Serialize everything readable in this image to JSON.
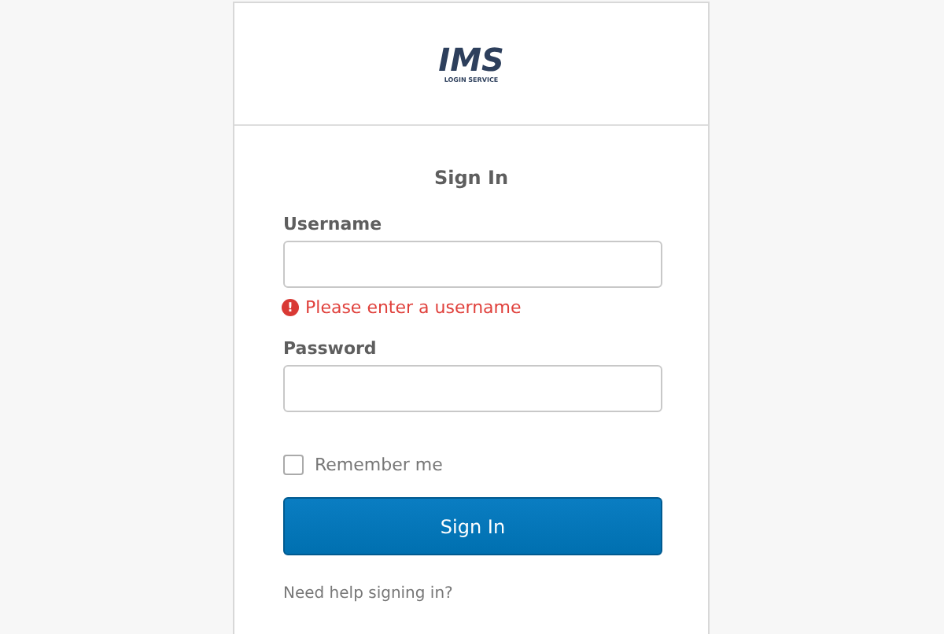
{
  "logo": {
    "name": "IMS",
    "subtitle": "LOGIN SERVICE"
  },
  "title": "Sign In",
  "fields": [
    {
      "label": "Username",
      "error": "Please enter a username",
      "icon": "!"
    },
    {
      "label": "Password"
    }
  ],
  "remember": {
    "label": "Remember me",
    "checked": false
  },
  "submit": "Sign In",
  "help_link": "Need help signing in?"
}
